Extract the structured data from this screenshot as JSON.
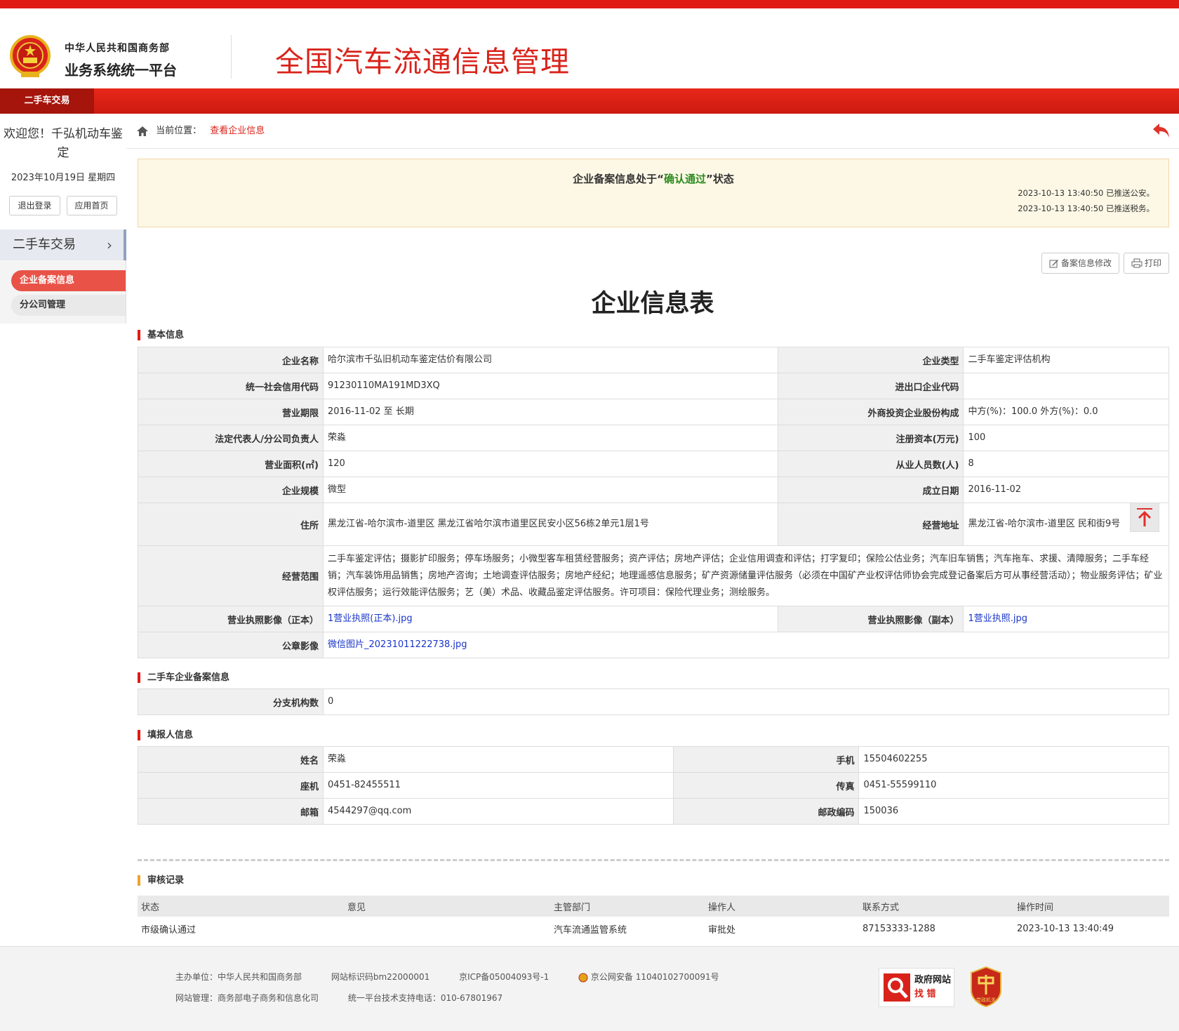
{
  "header": {
    "org_line1": "中华人民共和国商务部",
    "org_line2": "业务系统统一平台",
    "title": "全国汽车流通信息管理"
  },
  "nav": {
    "active_tab": "二手车交易"
  },
  "sidebar": {
    "welcome": "欢迎您！千弘机动车鉴定",
    "date": "2023年10月19日 星期四",
    "logout": "退出登录",
    "home": "应用首页",
    "group": "二手车交易",
    "items": [
      {
        "label": "企业备案信息",
        "active": true
      },
      {
        "label": "分公司管理",
        "active": false
      }
    ]
  },
  "breadcrumb": {
    "prefix": "当前位置：",
    "current": "查看企业信息"
  },
  "notice": {
    "status_prefix": "企业备案信息处于“",
    "status": "确认通过",
    "status_suffix": "”状态",
    "log1": "2023-10-13 13:40:50 已推送公安。",
    "log2": "2023-10-13 13:40:50 已推送税务。"
  },
  "toolbar": {
    "edit": "备案信息修改",
    "print": "打印"
  },
  "form_title": "企业信息表",
  "basic": {
    "section": "基本信息",
    "name_k": "企业名称",
    "name_v": "哈尔滨市千弘旧机动车鉴定估价有限公司",
    "type_k": "企业类型",
    "type_v": "二手车鉴定评估机构",
    "credit_k": "统一社会信用代码",
    "credit_v": "91230110MA191MD3XQ",
    "ie_k": "进出口企业代码",
    "ie_v": "",
    "term_k": "营业期限",
    "term_v": "2016-11-02 至  长期",
    "share_k": "外商投资企业股份构成",
    "share_v": "中方(%)：100.0  外方(%)：0.0",
    "legal_k": "法定代表人/分公司负责人",
    "legal_v": "荣淼",
    "capital_k": "注册资本(万元)",
    "capital_v": "100",
    "area_k": "营业面积(㎡)",
    "area_v": "120",
    "staff_k": "从业人员数(人)",
    "staff_v": "8",
    "scale_k": "企业规模",
    "scale_v": "微型",
    "found_k": "成立日期",
    "found_v": "2016-11-02",
    "addr_k": "住所",
    "addr_v": "黑龙江省-哈尔滨市-道里区 黑龙江省哈尔滨市道里区民安小区56栋2单元1层1号",
    "bizaddr_k": "经营地址",
    "bizaddr_v": "黑龙江省-哈尔滨市-道里区 民和街9号",
    "scope_k": "经营范围",
    "scope_v": "二手车鉴定评估；摄影扩印服务；停车场服务；小微型客车租赁经营服务；资产评估；房地产评估；企业信用调查和评估；打字复印；保险公估业务；汽车旧车销售；汽车拖车、求援、清障服务；二手车经销；汽车装饰用品销售；房地产咨询；土地调查评估服务；房地产经纪；地理遥感信息服务；矿产资源储量评估服务（必须在中国矿产业权评估师协会完成登记备案后方可从事经营活动）；物业服务评估；矿业权评估服务；运行效能评估服务；艺（美）术品、收藏品鉴定评估服务。许可项目：保险代理业务；测绘服务。",
    "lic1_k": "营业执照影像（正本）",
    "lic1_v": "1营业执照(正本).jpg",
    "lic2_k": "营业执照影像（副本）",
    "lic2_v": "1营业执照.jpg",
    "seal_k": "公章影像",
    "seal_v": "微信图片_20231011222738.jpg"
  },
  "usedcar": {
    "section": "二手车企业备案信息",
    "branch_k": "分支机构数",
    "branch_v": "0"
  },
  "filler": {
    "section": "填报人信息",
    "name_k": "姓名",
    "name_v": "荣淼",
    "mobile_k": "手机",
    "mobile_v": "15504602255",
    "tel_k": "座机",
    "tel_v": "0451-82455511",
    "fax_k": "传真",
    "fax_v": "0451-55599110",
    "email_k": "邮箱",
    "email_v": "4544297@qq.com",
    "zip_k": "邮政编码",
    "zip_v": "150036"
  },
  "audit": {
    "section": "审核记录",
    "headers": [
      "状态",
      "意见",
      "主管部门",
      "操作人",
      "联系方式",
      "操作时间"
    ],
    "row": [
      "市级确认通过",
      "",
      "汽车流通监管系统",
      "审批处",
      "87153333-1288",
      "2023-10-13 13:40:49"
    ]
  },
  "footer": {
    "sponsor": "主办单位：中华人民共和国商务部",
    "site_id": "网站标识码bm22000001",
    "icp": "京ICP备05004093号-1",
    "police": "京公网安备 11040102700091号",
    "manager": "网站管理：商务部电子商务和信息化司",
    "support": "统一平台技术支持电话：010-67801967",
    "zhaocuo_1": "政府网站",
    "zhaocuo_2": "找  错",
    "badge": "党政机关"
  }
}
